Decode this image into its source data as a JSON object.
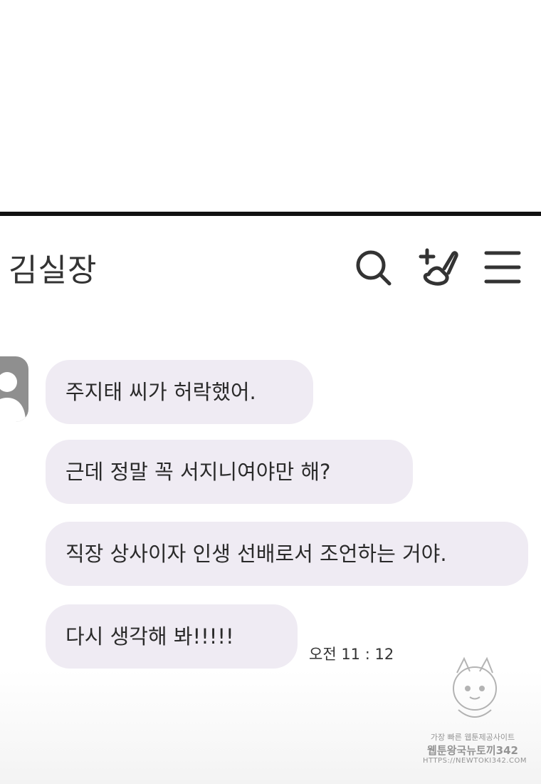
{
  "chat": {
    "title": "김실장",
    "messages": [
      {
        "text": "주지태 씨가 허락했어."
      },
      {
        "text": "근데 정말 꼭 서지니여야만 해?"
      },
      {
        "text": "직장 상사이자 인생 선배로서 조언하는 거야."
      },
      {
        "text": "다시 생각해 봐!!!!!"
      }
    ],
    "timestamp": "오전 11 : 12"
  },
  "header": {
    "icons": [
      "search-icon",
      "add-call-icon",
      "menu-icon"
    ]
  },
  "watermark": {
    "line1": "가장 빠른 웹툰제공사이트",
    "line2": "웹툰왕국뉴토끼342",
    "line3": "HTTPS://NEWTOKI342.COM"
  },
  "colors": {
    "bubble": "#efebf3",
    "text": "#2a2a2a",
    "avatar": "#8f8f8f",
    "border": "#111111"
  }
}
